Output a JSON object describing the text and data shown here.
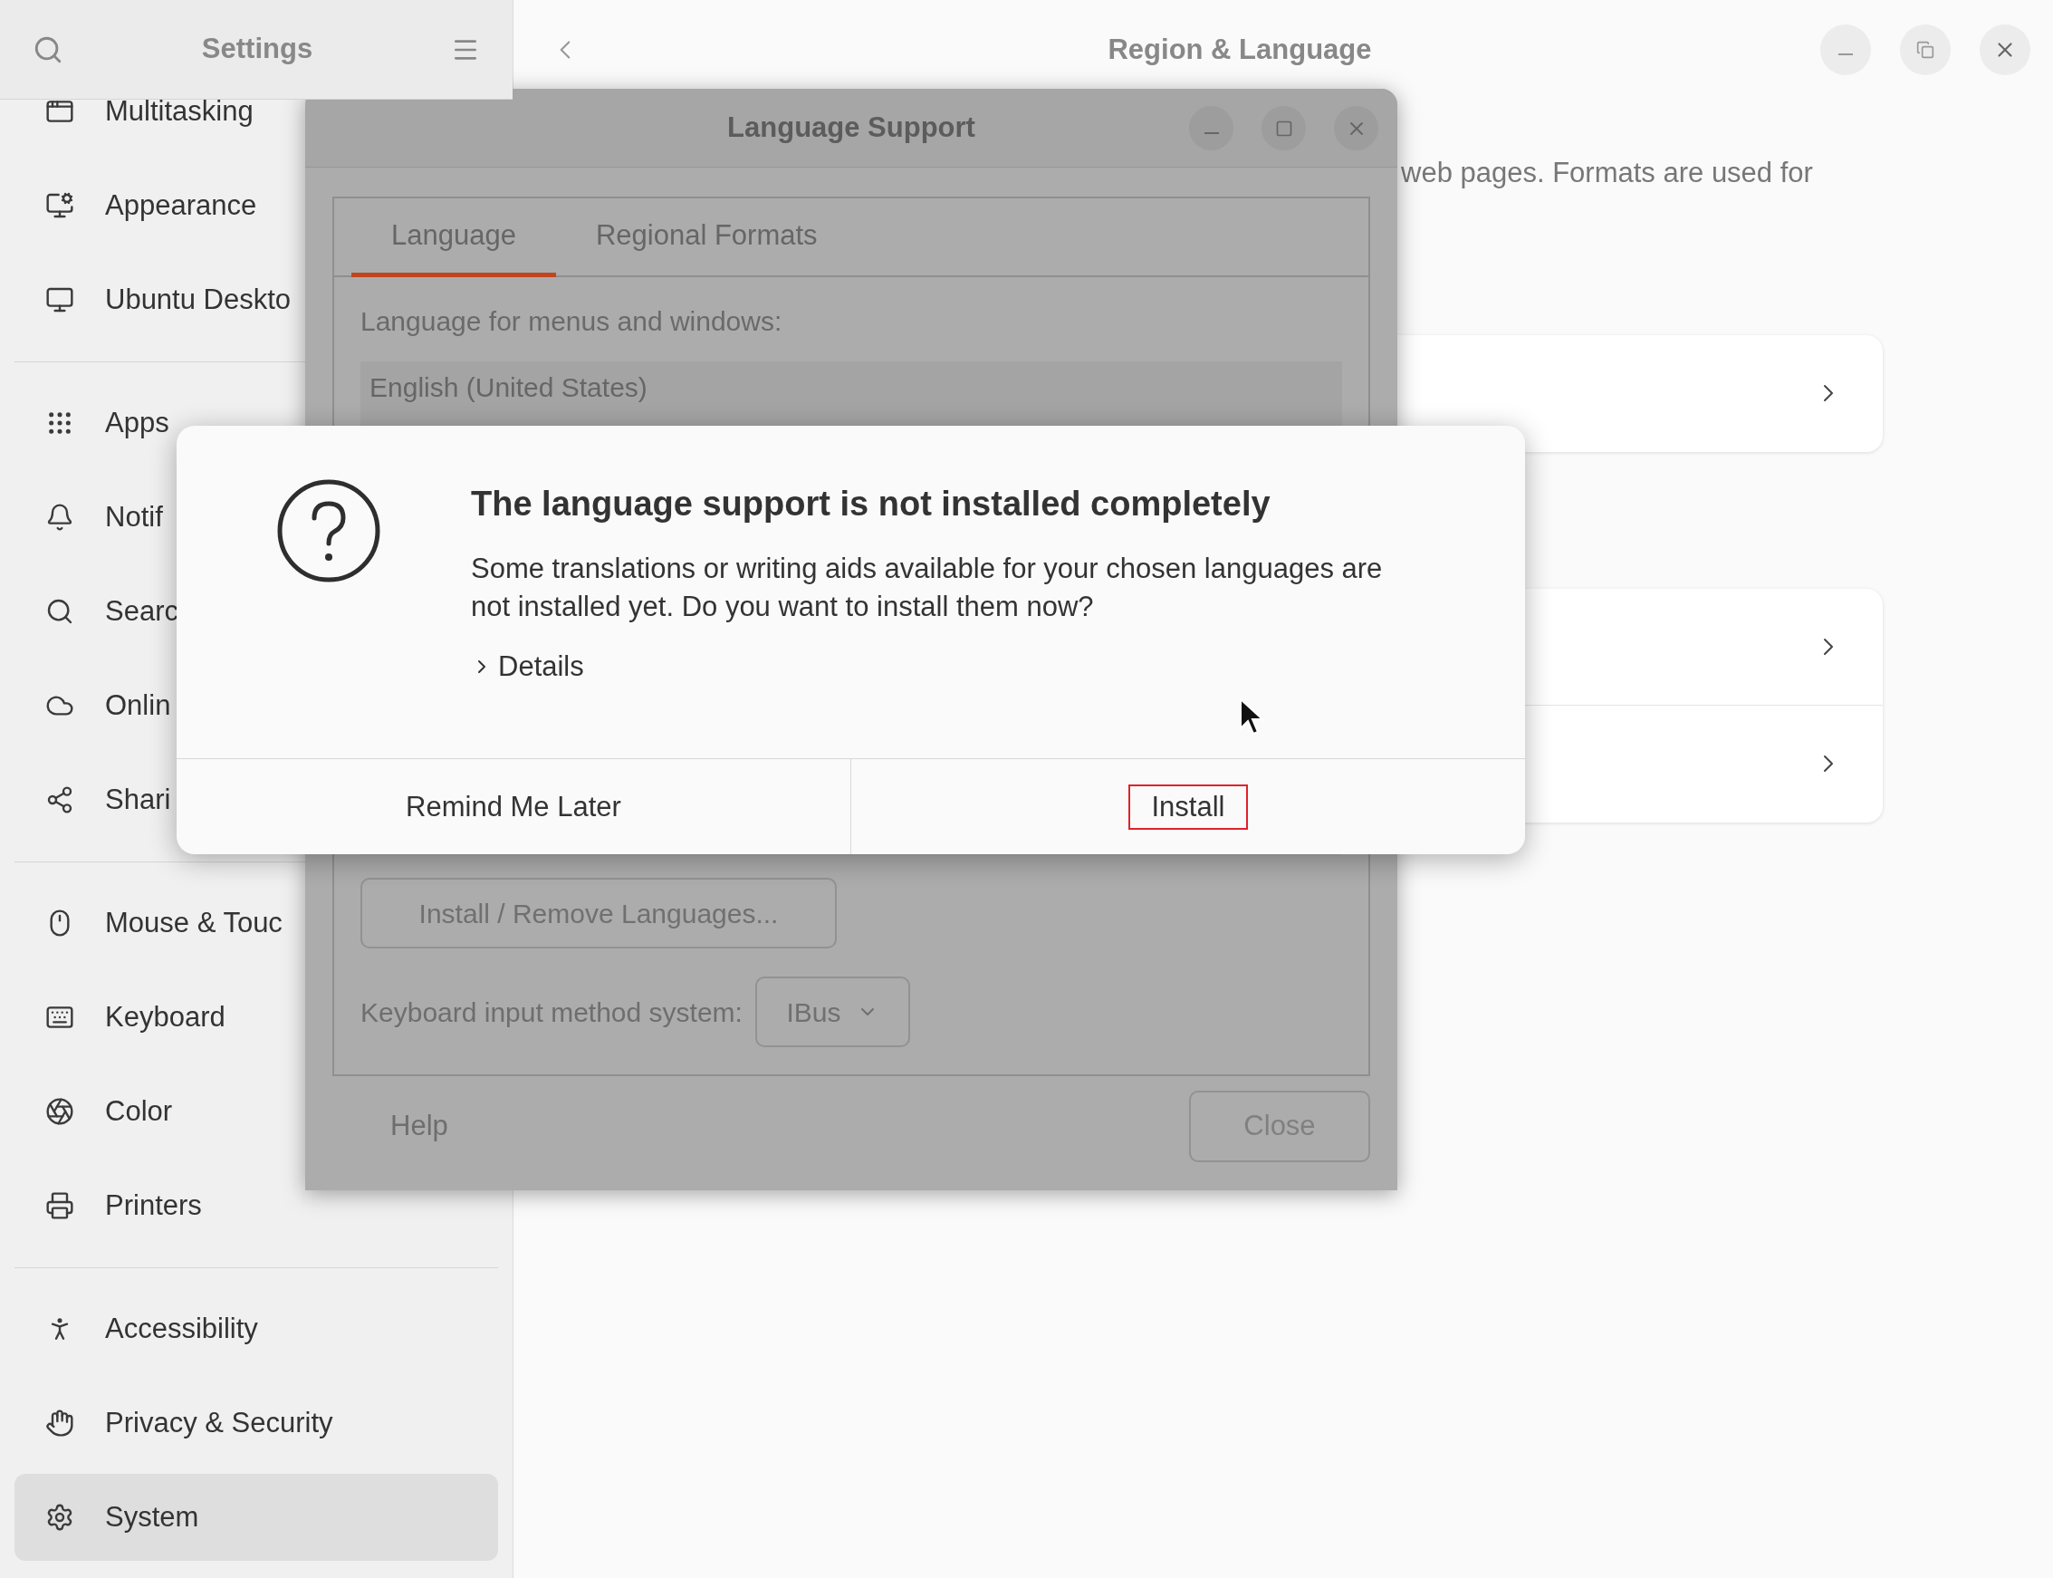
{
  "settings_window": {
    "sidebar_header": {
      "title": "Settings"
    },
    "sidebar": {
      "groups": [
        [
          {
            "label": "Multitasking",
            "selected": false
          },
          {
            "label": "Appearance",
            "selected": false
          },
          {
            "label": "Ubuntu Deskto",
            "selected": false
          }
        ],
        [
          {
            "label": "Apps",
            "selected": false
          },
          {
            "label": "Notif",
            "selected": false
          },
          {
            "label": "Searc",
            "selected": false
          },
          {
            "label": "Onlin",
            "selected": false
          },
          {
            "label": "Shari",
            "selected": false
          }
        ],
        [
          {
            "label": "Mouse & Touc",
            "selected": false
          },
          {
            "label": "Keyboard",
            "selected": false
          },
          {
            "label": "Color",
            "selected": false
          },
          {
            "label": "Printers",
            "selected": false
          }
        ],
        [
          {
            "label": "Accessibility",
            "selected": false
          },
          {
            "label": "Privacy & Security",
            "selected": false
          },
          {
            "label": "System",
            "selected": true
          }
        ]
      ]
    },
    "content": {
      "title": "Region & Language",
      "description": "web pages. Formats are used for"
    }
  },
  "language_support": {
    "title": "Language Support",
    "tabs": [
      {
        "label": "Language",
        "selected": true
      },
      {
        "label": "Regional Formats",
        "selected": false
      }
    ],
    "language_label": "Language for menus and windows:",
    "languages": [
      "English (United States)"
    ],
    "install_remove_button": "Install / Remove Languages...",
    "input_method_label": "Keyboard input method system:",
    "input_method_value": "IBus",
    "help_button": "Help",
    "close_button": "Close"
  },
  "message_dialog": {
    "title": "The language support is not installed completely",
    "body": "Some translations or writing aids available for your chosen languages are not installed yet. Do you want to install them now?",
    "details": {
      "label": "Details",
      "expanded": false
    },
    "buttons": [
      {
        "label": "Remind Me Later",
        "highlighted": false
      },
      {
        "label": "Install",
        "highlighted": true
      }
    ]
  }
}
